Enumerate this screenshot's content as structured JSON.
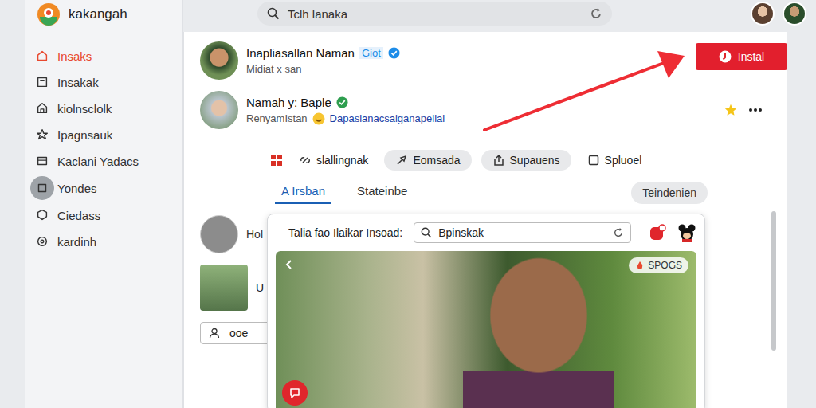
{
  "app": {
    "name": "kakangah"
  },
  "search": {
    "value": "Tclh lanaka"
  },
  "sidebar": {
    "items": [
      {
        "label": "Insaks",
        "selected": true
      },
      {
        "label": "Insakak",
        "selected": false
      },
      {
        "label": "kiolnsclolk",
        "selected": false
      },
      {
        "label": "Ipagnsauk",
        "selected": false
      },
      {
        "label": "Kaclani Yadacs",
        "selected": false
      },
      {
        "label": "Yondes",
        "selected": false
      },
      {
        "label": "Ciedass",
        "selected": false
      },
      {
        "label": "kardinh",
        "selected": false
      }
    ]
  },
  "posts": [
    {
      "name": "Inapliasallan Naman",
      "badge": "Giot",
      "check_color": "#1d8ce8",
      "subtitle": "Midiat x san",
      "link": ""
    },
    {
      "name": "Namah y: Baple",
      "badge": "",
      "check_color": "#2e9e4f",
      "subtitle": "RenyamIstan",
      "link": "Dapasianacsalganapeilal"
    }
  ],
  "install_button": "Instal",
  "chips": [
    {
      "label": "slallingnak",
      "kind": "plain"
    },
    {
      "label": "Eomsada",
      "kind": "pill"
    },
    {
      "label": "Supauens",
      "kind": "pill"
    },
    {
      "label": "Spluoel",
      "kind": "plain"
    }
  ],
  "tabs": [
    {
      "label": "A Irsban",
      "selected": true
    },
    {
      "label": "Stateinbe",
      "selected": false
    }
  ],
  "filter_button": "Teindenien",
  "feed": {
    "author": "Hol",
    "snippet": "U",
    "field": "ooe"
  },
  "panel": {
    "title": "Talia fao Ilaikar Insoad:",
    "search": "Bpinskak",
    "badge": "SPOGS"
  }
}
